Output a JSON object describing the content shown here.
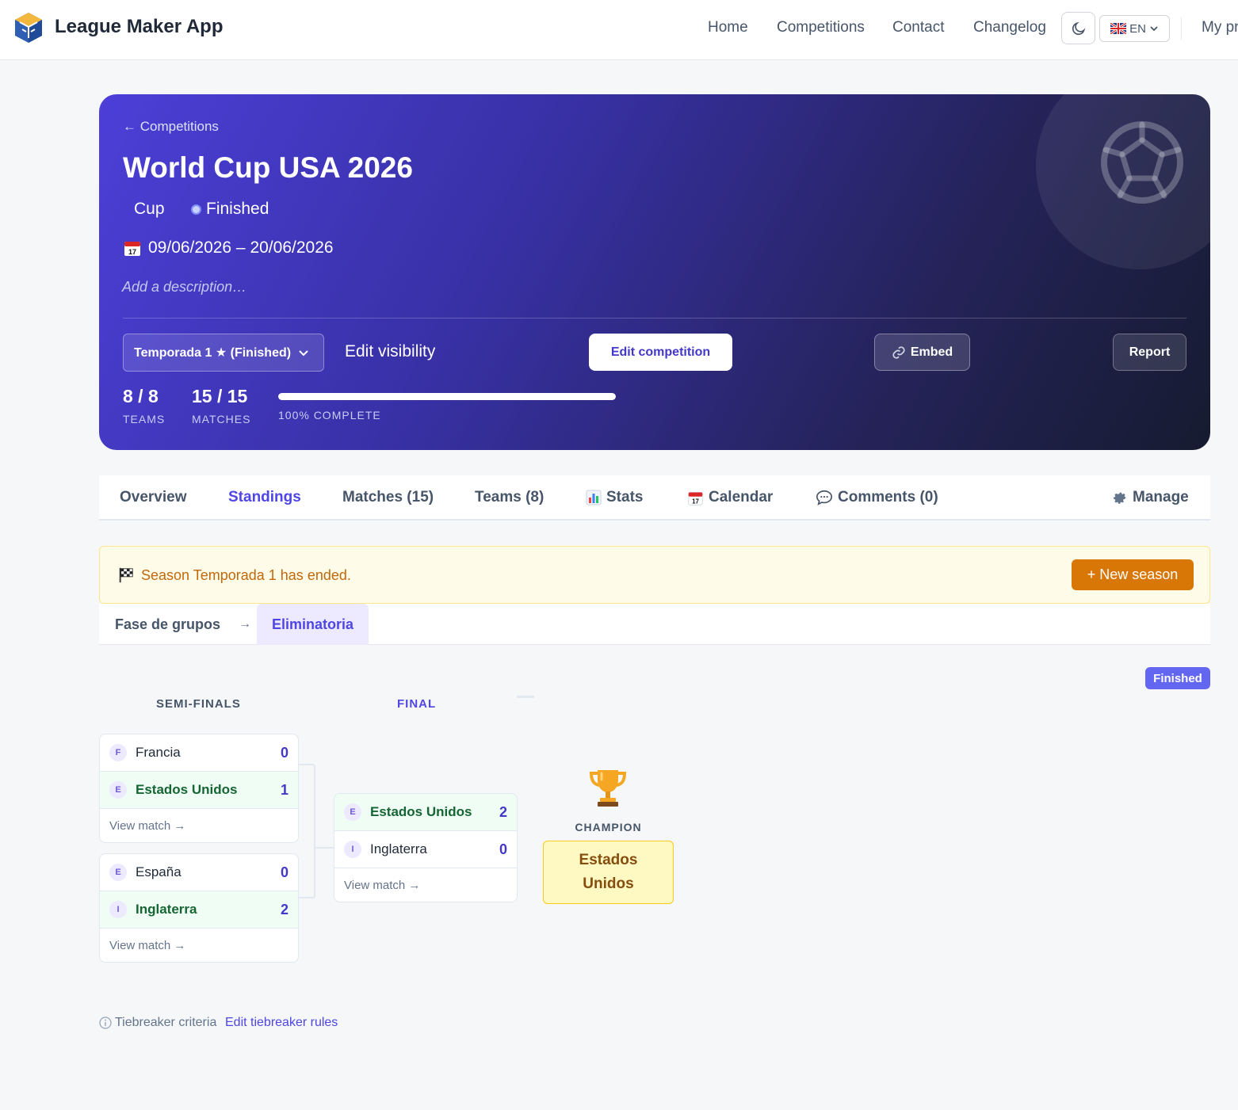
{
  "app": {
    "title": "League Maker App",
    "nav": [
      "Home",
      "Competitions",
      "Contact",
      "Changelog"
    ],
    "lang": "EN",
    "profile": "My pr"
  },
  "hero": {
    "back": "← Competitions",
    "title": "World Cup USA 2026",
    "type": "Cup",
    "status": "Finished",
    "dates": "09/06/2026 – 20/06/2026",
    "description_placeholder": "Add a description…",
    "season_select": "Temporada 1 ★ (Finished)",
    "edit_visibility": "Edit visibility",
    "edit_competition": "Edit competition",
    "embed": "Embed",
    "report": "Report",
    "teams_value": "8 / 8",
    "teams_label": "TEAMS",
    "matches_value": "15 / 15",
    "matches_label": "MATCHES",
    "progress_percent": 100,
    "progress_label": "100% COMPLETE"
  },
  "tabs": [
    {
      "label": "Overview"
    },
    {
      "label": "Standings",
      "active": true
    },
    {
      "label": "Matches (15)"
    },
    {
      "label": "Teams (8)"
    },
    {
      "label": "Stats",
      "icon": "bar-chart-icon"
    },
    {
      "label": "Calendar",
      "icon": "calendar-icon"
    },
    {
      "label": "Comments (0)",
      "icon": "speech-bubble-icon"
    },
    {
      "label": "Manage",
      "icon": "gear-icon"
    }
  ],
  "alert": {
    "text": "Season Temporada 1 has ended.",
    "button": "+ New season"
  },
  "phases": {
    "group": "Fase de grupos",
    "arrow": "→",
    "knockout": "Eliminatoria"
  },
  "bracket": {
    "badge": "Finished",
    "semifinals_title": "SEMI-FINALS",
    "final_title": "FINAL",
    "semifinals": [
      {
        "teams": [
          {
            "initial": "F",
            "name": "Francia",
            "score": "0",
            "winner": false
          },
          {
            "initial": "E",
            "name": "Estados Unidos",
            "score": "1",
            "winner": true
          }
        ],
        "link": "View match →"
      },
      {
        "teams": [
          {
            "initial": "E",
            "name": "España",
            "score": "0",
            "winner": false
          },
          {
            "initial": "I",
            "name": "Inglaterra",
            "score": "2",
            "winner": true
          }
        ],
        "link": "View match →"
      }
    ],
    "final": {
      "teams": [
        {
          "initial": "E",
          "name": "Estados Unidos",
          "score": "2",
          "winner": true
        },
        {
          "initial": "I",
          "name": "Inglaterra",
          "score": "0",
          "winner": false
        }
      ],
      "link": "View match →"
    },
    "champion_label": "CHAMPION",
    "champion": "Estados Unidos"
  },
  "footer": {
    "tiebreak_label": "Tiebreaker criteria",
    "tiebreak_link": "Edit tiebreaker rules"
  },
  "colors": {
    "accent": "#4f46e5",
    "warning": "#d97706",
    "winner_bg": "#f0fdf4",
    "champion_bg": "#fef9c3"
  }
}
